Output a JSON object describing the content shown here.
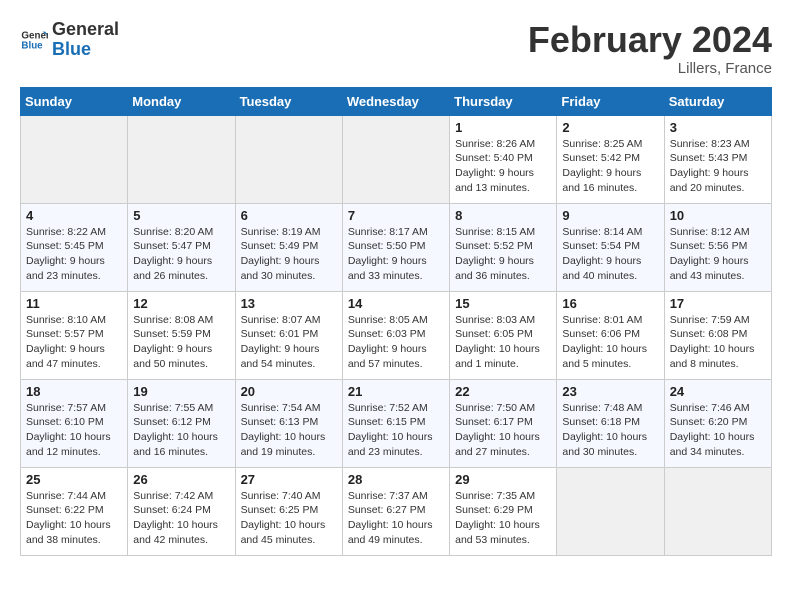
{
  "header": {
    "logo_general": "General",
    "logo_blue": "Blue",
    "month_year": "February 2024",
    "location": "Lillers, France"
  },
  "calendar": {
    "days_of_week": [
      "Sunday",
      "Monday",
      "Tuesday",
      "Wednesday",
      "Thursday",
      "Friday",
      "Saturday"
    ],
    "weeks": [
      [
        {
          "day": "",
          "info": ""
        },
        {
          "day": "",
          "info": ""
        },
        {
          "day": "",
          "info": ""
        },
        {
          "day": "",
          "info": ""
        },
        {
          "day": "1",
          "info": "Sunrise: 8:26 AM\nSunset: 5:40 PM\nDaylight: 9 hours\nand 13 minutes."
        },
        {
          "day": "2",
          "info": "Sunrise: 8:25 AM\nSunset: 5:42 PM\nDaylight: 9 hours\nand 16 minutes."
        },
        {
          "day": "3",
          "info": "Sunrise: 8:23 AM\nSunset: 5:43 PM\nDaylight: 9 hours\nand 20 minutes."
        }
      ],
      [
        {
          "day": "4",
          "info": "Sunrise: 8:22 AM\nSunset: 5:45 PM\nDaylight: 9 hours\nand 23 minutes."
        },
        {
          "day": "5",
          "info": "Sunrise: 8:20 AM\nSunset: 5:47 PM\nDaylight: 9 hours\nand 26 minutes."
        },
        {
          "day": "6",
          "info": "Sunrise: 8:19 AM\nSunset: 5:49 PM\nDaylight: 9 hours\nand 30 minutes."
        },
        {
          "day": "7",
          "info": "Sunrise: 8:17 AM\nSunset: 5:50 PM\nDaylight: 9 hours\nand 33 minutes."
        },
        {
          "day": "8",
          "info": "Sunrise: 8:15 AM\nSunset: 5:52 PM\nDaylight: 9 hours\nand 36 minutes."
        },
        {
          "day": "9",
          "info": "Sunrise: 8:14 AM\nSunset: 5:54 PM\nDaylight: 9 hours\nand 40 minutes."
        },
        {
          "day": "10",
          "info": "Sunrise: 8:12 AM\nSunset: 5:56 PM\nDaylight: 9 hours\nand 43 minutes."
        }
      ],
      [
        {
          "day": "11",
          "info": "Sunrise: 8:10 AM\nSunset: 5:57 PM\nDaylight: 9 hours\nand 47 minutes."
        },
        {
          "day": "12",
          "info": "Sunrise: 8:08 AM\nSunset: 5:59 PM\nDaylight: 9 hours\nand 50 minutes."
        },
        {
          "day": "13",
          "info": "Sunrise: 8:07 AM\nSunset: 6:01 PM\nDaylight: 9 hours\nand 54 minutes."
        },
        {
          "day": "14",
          "info": "Sunrise: 8:05 AM\nSunset: 6:03 PM\nDaylight: 9 hours\nand 57 minutes."
        },
        {
          "day": "15",
          "info": "Sunrise: 8:03 AM\nSunset: 6:05 PM\nDaylight: 10 hours\nand 1 minute."
        },
        {
          "day": "16",
          "info": "Sunrise: 8:01 AM\nSunset: 6:06 PM\nDaylight: 10 hours\nand 5 minutes."
        },
        {
          "day": "17",
          "info": "Sunrise: 7:59 AM\nSunset: 6:08 PM\nDaylight: 10 hours\nand 8 minutes."
        }
      ],
      [
        {
          "day": "18",
          "info": "Sunrise: 7:57 AM\nSunset: 6:10 PM\nDaylight: 10 hours\nand 12 minutes."
        },
        {
          "day": "19",
          "info": "Sunrise: 7:55 AM\nSunset: 6:12 PM\nDaylight: 10 hours\nand 16 minutes."
        },
        {
          "day": "20",
          "info": "Sunrise: 7:54 AM\nSunset: 6:13 PM\nDaylight: 10 hours\nand 19 minutes."
        },
        {
          "day": "21",
          "info": "Sunrise: 7:52 AM\nSunset: 6:15 PM\nDaylight: 10 hours\nand 23 minutes."
        },
        {
          "day": "22",
          "info": "Sunrise: 7:50 AM\nSunset: 6:17 PM\nDaylight: 10 hours\nand 27 minutes."
        },
        {
          "day": "23",
          "info": "Sunrise: 7:48 AM\nSunset: 6:18 PM\nDaylight: 10 hours\nand 30 minutes."
        },
        {
          "day": "24",
          "info": "Sunrise: 7:46 AM\nSunset: 6:20 PM\nDaylight: 10 hours\nand 34 minutes."
        }
      ],
      [
        {
          "day": "25",
          "info": "Sunrise: 7:44 AM\nSunset: 6:22 PM\nDaylight: 10 hours\nand 38 minutes."
        },
        {
          "day": "26",
          "info": "Sunrise: 7:42 AM\nSunset: 6:24 PM\nDaylight: 10 hours\nand 42 minutes."
        },
        {
          "day": "27",
          "info": "Sunrise: 7:40 AM\nSunset: 6:25 PM\nDaylight: 10 hours\nand 45 minutes."
        },
        {
          "day": "28",
          "info": "Sunrise: 7:37 AM\nSunset: 6:27 PM\nDaylight: 10 hours\nand 49 minutes."
        },
        {
          "day": "29",
          "info": "Sunrise: 7:35 AM\nSunset: 6:29 PM\nDaylight: 10 hours\nand 53 minutes."
        },
        {
          "day": "",
          "info": ""
        },
        {
          "day": "",
          "info": ""
        }
      ]
    ]
  }
}
